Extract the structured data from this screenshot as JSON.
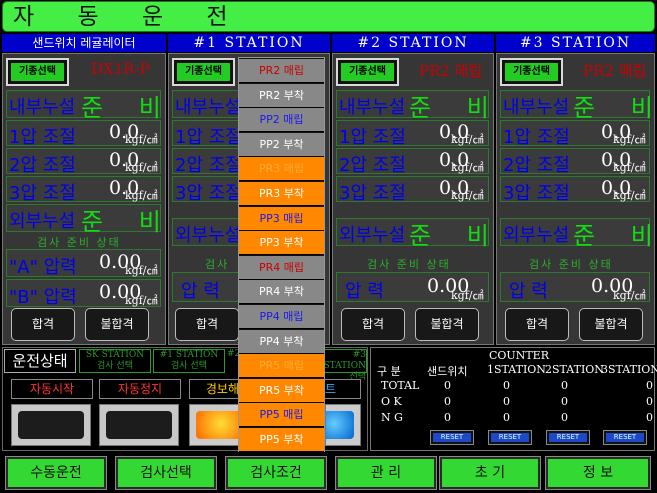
{
  "title": "자 동 운 전",
  "columns": [
    {
      "header": "샌드위치 레귤레이터",
      "select_button": "기종선택",
      "selected": "DX1R-P",
      "rows": [
        {
          "label": "내부누설",
          "value": "준 비"
        },
        {
          "label": "1압 조절",
          "value": "0.0",
          "unit": "kgf/㎠"
        },
        {
          "label": "2압 조절",
          "value": "0.0",
          "unit": "kgf/㎠"
        },
        {
          "label": "3압 조절",
          "value": "0.0",
          "unit": "kgf/㎠"
        },
        {
          "label": "외부누설",
          "value": "준 비"
        }
      ],
      "status": "검사 준비 상태",
      "pressures": [
        {
          "label": "\"A\" 압력",
          "value": "0.00",
          "unit": "kgf/㎠"
        },
        {
          "label": "\"B\" 압력",
          "value": "0.00",
          "unit": "kgf/㎠"
        }
      ],
      "pass": "합격",
      "fail": "불합격"
    },
    {
      "header": "#1 STATION",
      "select_button": "기종선택",
      "selected": "",
      "rows": [
        {
          "label": "내부누설",
          "value": ""
        },
        {
          "label": "1압 조절",
          "value": ""
        },
        {
          "label": "2압 조절",
          "value": ""
        },
        {
          "label": "3압 조절",
          "value": ""
        },
        {
          "label": "외부누설",
          "value": ""
        }
      ],
      "status": "검사 ",
      "pressures": [
        {
          "label": "압 력",
          "value": ""
        }
      ],
      "pass": "합격",
      "fail": ""
    },
    {
      "header": "#2 STATION",
      "select_button": "기종선택",
      "selected": "PR2 매립",
      "rows": [
        {
          "label": "내부누설",
          "value": "준 비"
        },
        {
          "label": "1압 조절",
          "value": "0.0",
          "unit": "kgf/㎠"
        },
        {
          "label": "2압 조절",
          "value": "0.0",
          "unit": "kgf/㎠"
        },
        {
          "label": "3압 조절",
          "value": "0.0",
          "unit": "kgf/㎠"
        },
        {
          "label": "외부누설",
          "value": "준 비"
        }
      ],
      "status": "검사 준비 상태",
      "pressures": [
        {
          "label": "압 력",
          "value": "0.00",
          "unit": "kgf/㎠"
        }
      ],
      "pass": "합격",
      "fail": "불합격"
    },
    {
      "header": "#3 STATION",
      "select_button": "기종선택",
      "selected": "PR2 매립",
      "rows": [
        {
          "label": "내부누설",
          "value": "준 비"
        },
        {
          "label": "1압 조절",
          "value": "0.0",
          "unit": "kgf/㎠"
        },
        {
          "label": "2압 조절",
          "value": "0.0",
          "unit": "kgf/㎠"
        },
        {
          "label": "3압 조절",
          "value": "0.0",
          "unit": "kgf/㎠"
        },
        {
          "label": "외부누설",
          "value": "준 비"
        }
      ],
      "status": "검사 준비 상태",
      "pressures": [
        {
          "label": "압 력",
          "value": "0.00",
          "unit": "kgf/㎠"
        }
      ],
      "pass": "합격",
      "fail": "불합격"
    }
  ],
  "dropdown": [
    {
      "label": "PR2 매립",
      "bg": "#888888",
      "fg": "#cc0000"
    },
    {
      "label": "PR2 부착",
      "bg": "#888888",
      "fg": "#ffffff"
    },
    {
      "label": "PP2 매립",
      "bg": "#888888",
      "fg": "#1a1aee"
    },
    {
      "label": "PP2 부착",
      "bg": "#888888",
      "fg": "#ffffff"
    },
    {
      "label": "PR3 매립",
      "bg": "#ff8800",
      "fg": "#ffaa33"
    },
    {
      "label": "PR3 부착",
      "bg": "#ff8800",
      "fg": "#ffffff"
    },
    {
      "label": "PP3 매립",
      "bg": "#ff8800",
      "fg": "#1a1aee"
    },
    {
      "label": "PP3 부착",
      "bg": "#ff8800",
      "fg": "#ffffff"
    },
    {
      "label": "PR4 매립",
      "bg": "#888888",
      "fg": "#cc0000"
    },
    {
      "label": "PR4 부착",
      "bg": "#888888",
      "fg": "#ffffff"
    },
    {
      "label": "PP4 매립",
      "bg": "#888888",
      "fg": "#1a1aee"
    },
    {
      "label": "PP4 부착",
      "bg": "#888888",
      "fg": "#ffffff"
    },
    {
      "label": "PR5 매립",
      "bg": "#ff8800",
      "fg": "#ffaa33"
    },
    {
      "label": "PR5 부착",
      "bg": "#ff8800",
      "fg": "#ffffff"
    },
    {
      "label": "PP5 매립",
      "bg": "#ff8800",
      "fg": "#1a1aee"
    },
    {
      "label": "PP5 부착",
      "bg": "#ff8800",
      "fg": "#ffffff"
    }
  ],
  "operation": {
    "title": "운전상태",
    "tabs": [
      {
        "line1": "SK STATION",
        "line2": "검사 선택"
      },
      {
        "line1": "#1 STATION",
        "line2": "검사 선택"
      },
      {
        "line1": "#2",
        "line2": ""
      },
      {
        "line1": "#3 STATION",
        "line2": "선택"
      }
    ],
    "auto_start": "자동시작",
    "auto_stop": "자동정지",
    "alarm": "경보해",
    "reset_partial": "트"
  },
  "counter": {
    "title": "COUNTER",
    "headers": [
      "구 분",
      "샌드위치",
      "1STATION",
      "2STATION",
      "3STATION"
    ],
    "rows": [
      {
        "label": "TOTAL",
        "values": [
          "0",
          "0",
          "0",
          "0"
        ]
      },
      {
        "label": "O K",
        "values": [
          "0",
          "0",
          "0",
          "0"
        ]
      },
      {
        "label": "N G",
        "values": [
          "0",
          "0",
          "0",
          "0"
        ]
      }
    ],
    "reset_label": "RESET"
  },
  "bottom_nav": [
    "수동운전",
    "검사선택",
    "검사조건",
    "관 리",
    "초 기",
    "정 보"
  ]
}
